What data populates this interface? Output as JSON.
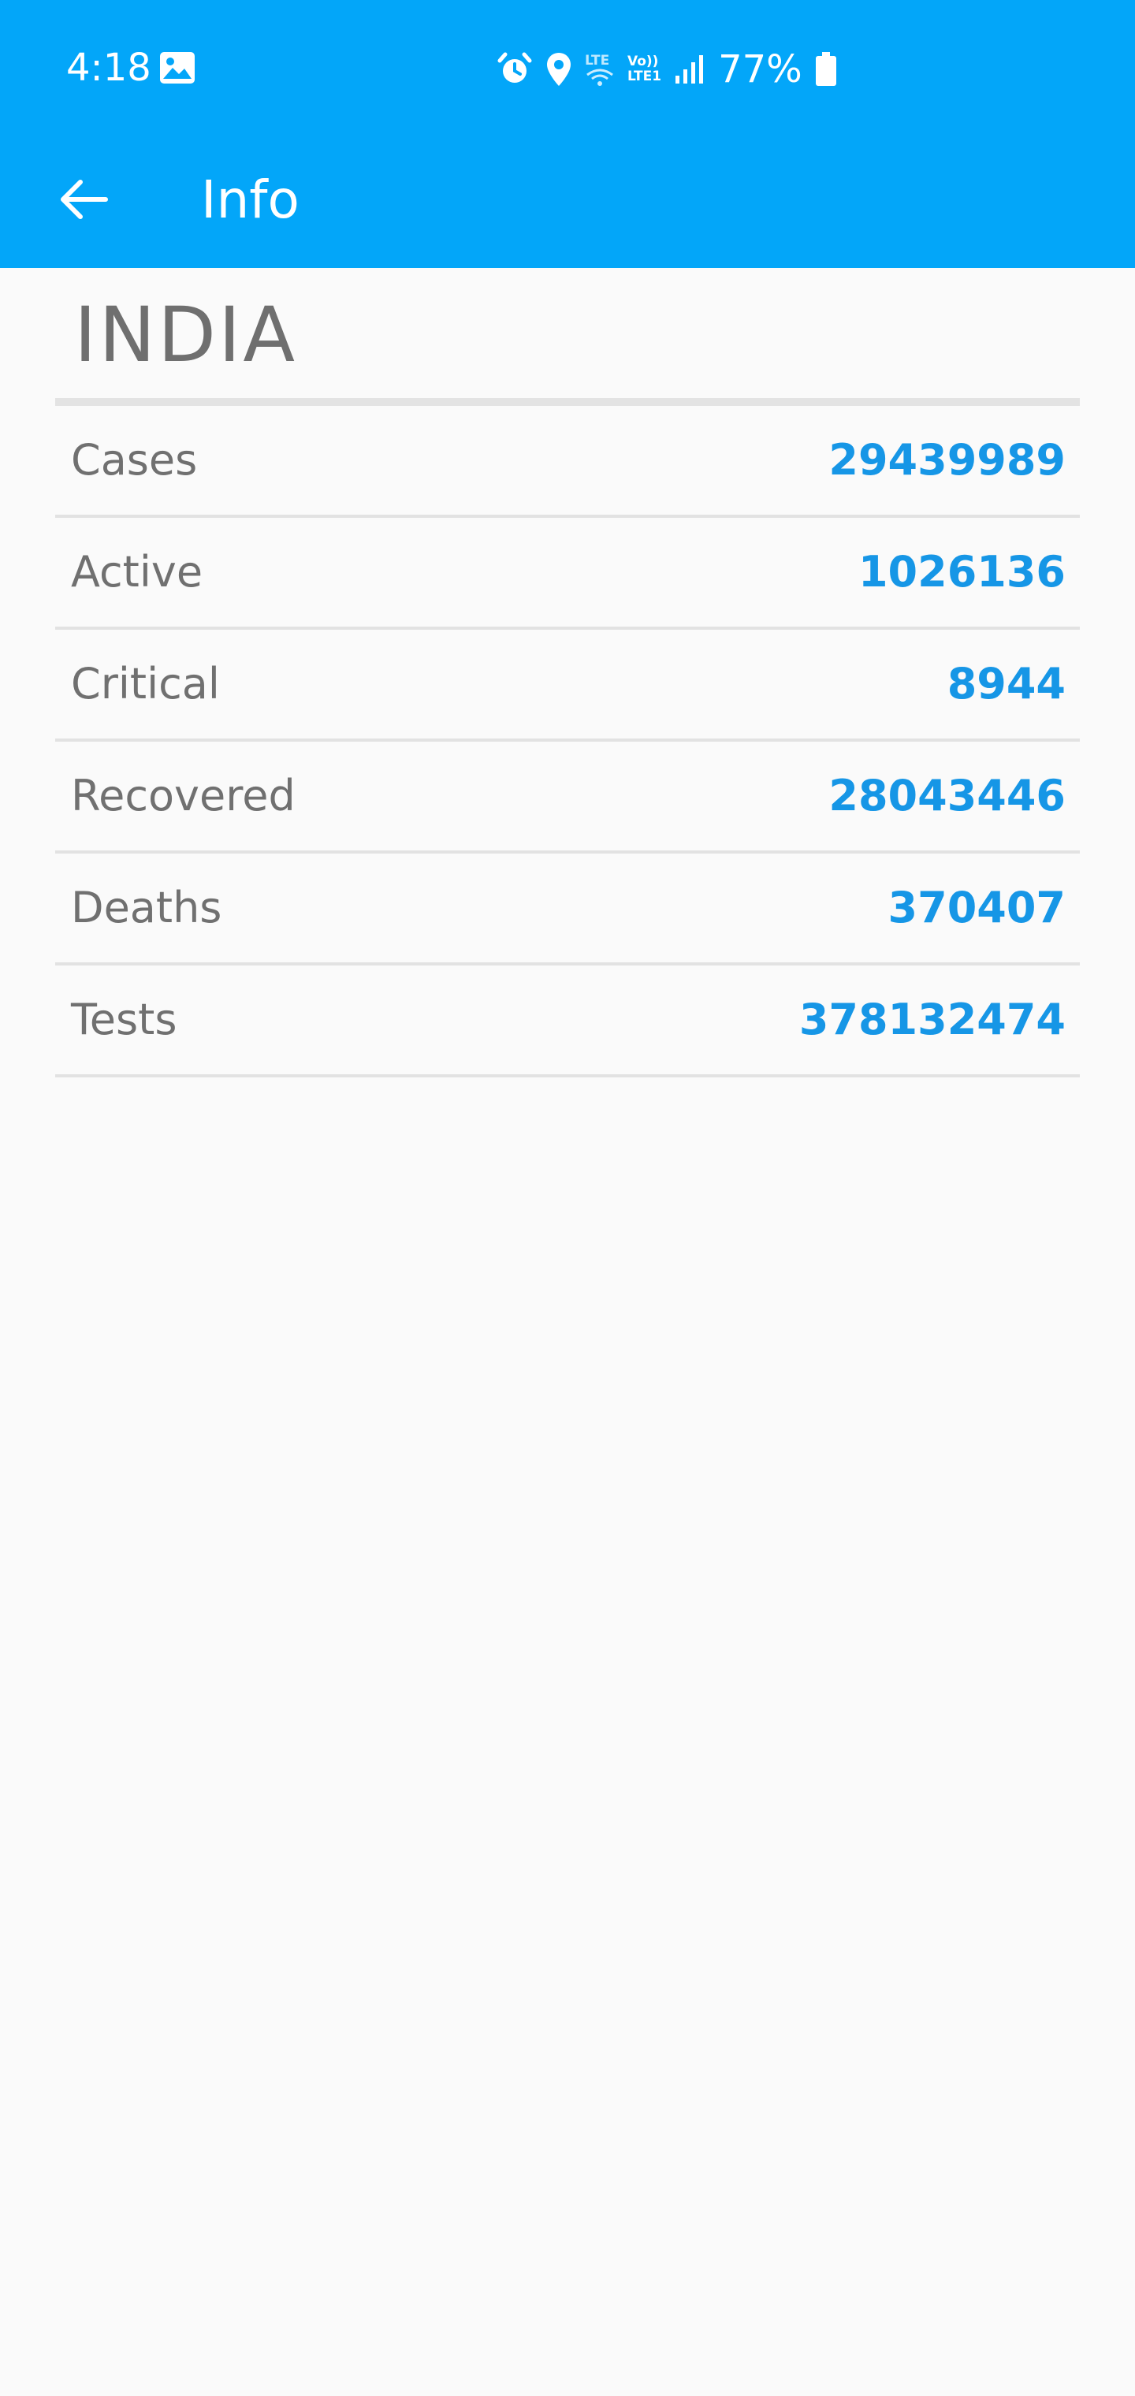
{
  "status_bar": {
    "time": "4:18",
    "battery": "77%",
    "network_1": [
      "LTE",
      ""
    ],
    "network_2": [
      "Vo))",
      "LTE1"
    ],
    "icons": [
      "gallery-icon",
      "alarm-icon",
      "location-icon",
      "wifi-icon",
      "signal-icon",
      "battery-icon"
    ]
  },
  "toolbar": {
    "title": "Info",
    "back_icon": "arrow-back-icon"
  },
  "country": {
    "name": "INDIA"
  },
  "stats": [
    {
      "label": "Cases",
      "value": "29439989"
    },
    {
      "label": "Active",
      "value": "1026136"
    },
    {
      "label": "Critical",
      "value": "8944"
    },
    {
      "label": "Recovered",
      "value": "28043446"
    },
    {
      "label": "Deaths",
      "value": "370407"
    },
    {
      "label": "Tests",
      "value": "378132474"
    }
  ],
  "colors": {
    "app_bar": "#03a6f9",
    "background": "#fafafa",
    "value_text": "#1696e6",
    "label_text": "#707070",
    "divider": "#e2e2e2"
  }
}
